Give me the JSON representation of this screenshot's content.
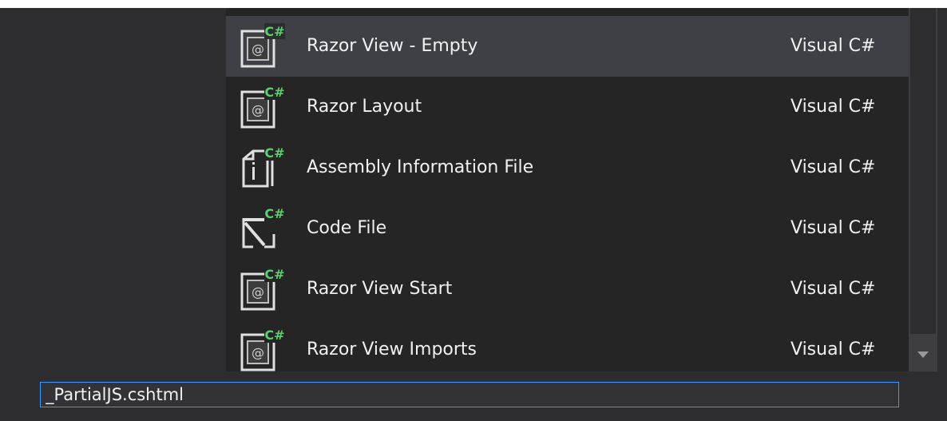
{
  "items": [
    {
      "name": "Razor View - Empty",
      "lang": "Visual C#",
      "icon": "razor-view-icon",
      "selected": true
    },
    {
      "name": "Razor Layout",
      "lang": "Visual C#",
      "icon": "razor-layout-icon",
      "selected": false
    },
    {
      "name": "Assembly Information File",
      "lang": "Visual C#",
      "icon": "assembly-info-icon",
      "selected": false
    },
    {
      "name": "Code File",
      "lang": "Visual C#",
      "icon": "code-file-icon",
      "selected": false
    },
    {
      "name": "Razor View Start",
      "lang": "Visual C#",
      "icon": "razor-view-start-icon",
      "selected": false
    },
    {
      "name": "Razor View Imports",
      "lang": "Visual C#",
      "icon": "razor-view-imports-icon",
      "selected": false
    }
  ],
  "filename": {
    "value": "_PartialJS.cshtml"
  },
  "badge": {
    "text": "C#"
  },
  "colors": {
    "accent": "#3399ff",
    "badge": "#56d36b",
    "selected_row": "#3f3f46"
  }
}
